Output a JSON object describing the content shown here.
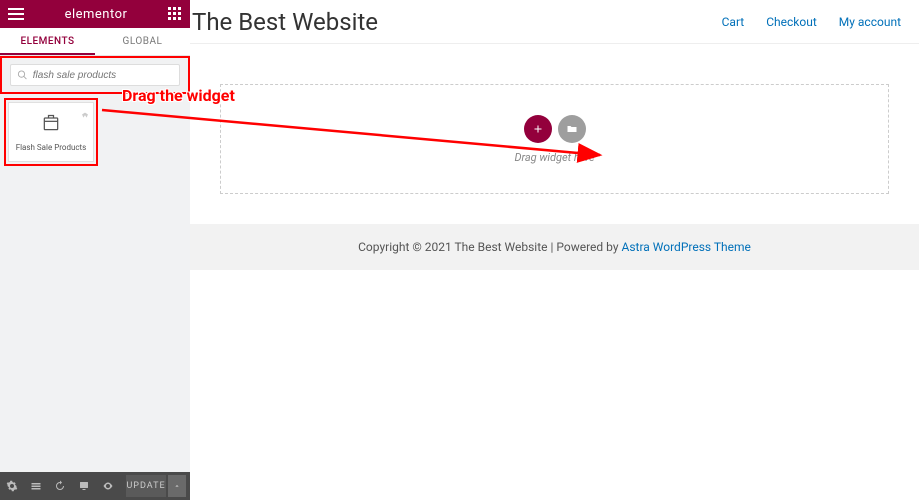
{
  "brand": "elementor",
  "tabs": {
    "elements": "ELEMENTS",
    "global": "GLOBAL"
  },
  "search": {
    "placeholder": "flash sale products"
  },
  "widget": {
    "label": "Flash Sale Products"
  },
  "footer_toolbar": {
    "update": "UPDATE"
  },
  "site": {
    "title": "The Best Website",
    "nav": {
      "cart": "Cart",
      "checkout": "Checkout",
      "account": "My account"
    },
    "dropzone": {
      "hint": "Drag widget here"
    },
    "footer": {
      "copyright": "Copyright © 2021 The Best Website | Powered by ",
      "theme_link": "Astra WordPress Theme"
    }
  },
  "annotation": {
    "label": "Drag the widget"
  }
}
